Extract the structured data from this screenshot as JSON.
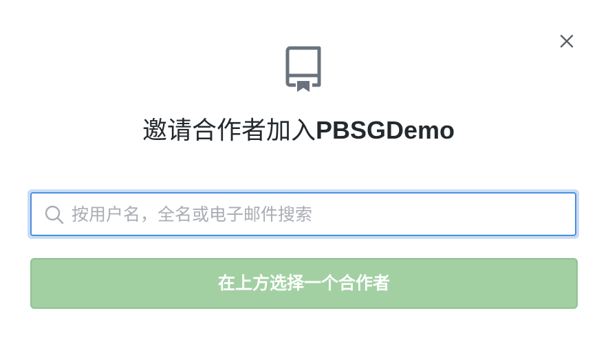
{
  "dialog": {
    "title_prefix": "邀请合作者加入",
    "repo_name": "PBSGDemo",
    "close_icon": "close-icon",
    "header_icon": "repo-icon"
  },
  "search": {
    "placeholder": "按用户名，全名或电子邮件搜索",
    "value": "",
    "icon": "search-icon"
  },
  "submit": {
    "label": "在上方选择一个合作者",
    "disabled": true
  },
  "colors": {
    "title_text": "#24292e",
    "input_border_focus": "#4a8fe0",
    "input_focus_ring": "#c9dcf6",
    "placeholder": "#a8adb3",
    "button_disabled_bg": "#a2d0a3",
    "button_text": "#ffffff",
    "icon_gray": "#6a737d"
  }
}
